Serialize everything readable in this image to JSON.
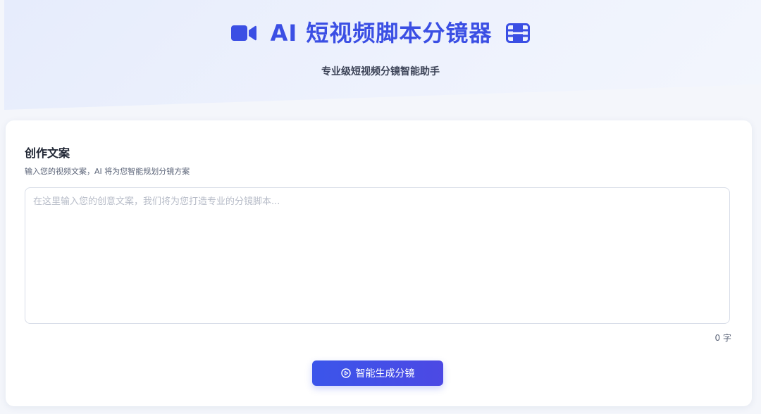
{
  "header": {
    "title": "AI 短视频脚本分镜器",
    "subtitle": "专业级短视频分镜智能助手",
    "left_icon": "video-camera-icon",
    "right_icon": "film-icon",
    "accent_color": "#3b4fe4"
  },
  "editor": {
    "section_title": "创作文案",
    "section_desc": "输入您的视频文案，AI 将为您智能规划分镜方案",
    "placeholder": "在这里输入您的创意文案，我们将为您打造专业的分镜脚本...",
    "value": "",
    "char_count": "0 字"
  },
  "actions": {
    "generate_label": "智能生成分镜",
    "generate_icon": "play-circle-icon",
    "button_color": "#3b55ea"
  }
}
